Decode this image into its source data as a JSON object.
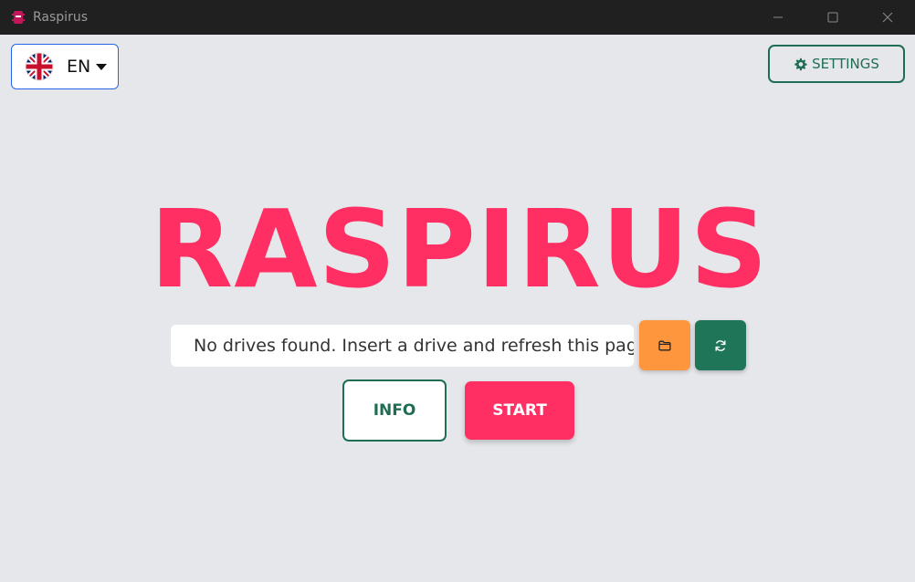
{
  "window": {
    "title": "Raspirus",
    "app_icon": "raspirus-icon",
    "controls": [
      "minimize-icon",
      "maximize-icon",
      "close-icon"
    ]
  },
  "language": {
    "current": "EN",
    "flag": "uk-flag-icon",
    "dropdown_icon": "caret-down-icon"
  },
  "settings": {
    "label": "SETTINGS",
    "icon": "gear-icon"
  },
  "brand": {
    "title": "RASPIRUS"
  },
  "drive": {
    "selected_text": "No drives found. Insert a drive and refresh this page",
    "folder_icon": "folder-icon",
    "refresh_icon": "refresh-icon"
  },
  "actions": {
    "info_label": "INFO",
    "start_label": "START"
  },
  "colors": {
    "brand": "#ff2e63",
    "primary_green": "#1f7558",
    "warning_orange": "#fd963d",
    "background": "#e5e7eb",
    "titlebar": "#202020"
  }
}
